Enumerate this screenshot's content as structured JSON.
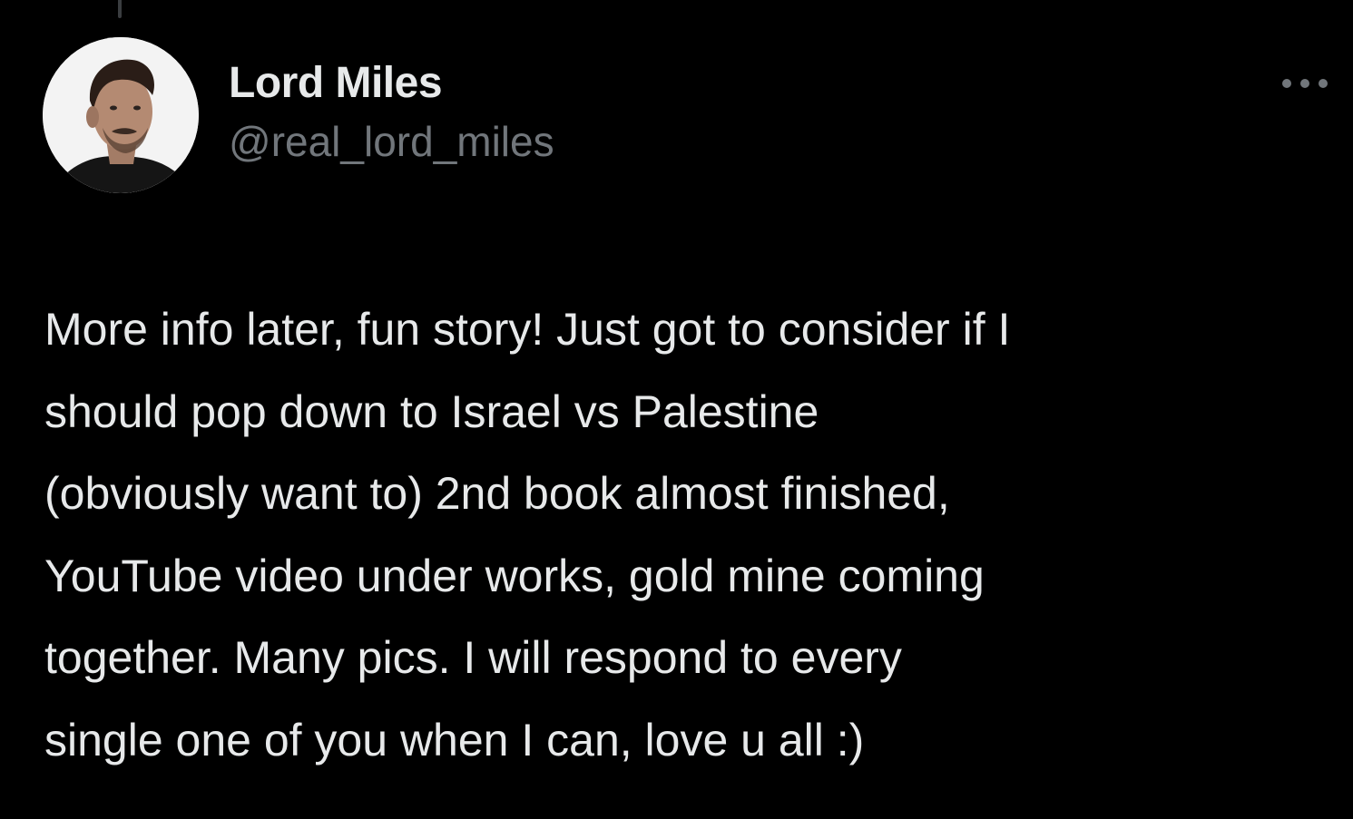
{
  "colors": {
    "background": "#000000",
    "primary_text": "#e7e9ea",
    "secondary_text": "#71767b",
    "thread_line": "#3a3d40"
  },
  "icons": {
    "avatar": "avatar-photo",
    "more": "more-horizontal-icon"
  },
  "tweet": {
    "author": {
      "display_name": "Lord Miles",
      "handle": "@real_lord_miles"
    },
    "lines": [
      "More info later, fun story! Just got to consider if I",
      "should pop down to Israel vs Palestine",
      "(obviously want to) 2nd book almost finished,",
      "YouTube video under works, gold mine coming",
      "together. Many pics. I will respond to every",
      "single one of you when I can, love u all :)"
    ]
  }
}
